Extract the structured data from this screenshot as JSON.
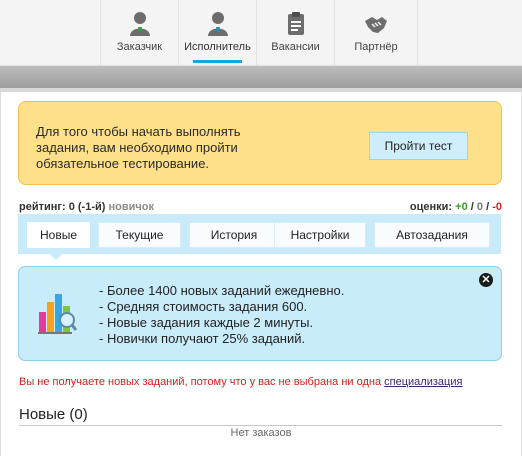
{
  "nav": {
    "tabs": [
      {
        "label": "Заказчик",
        "icon": "customer-user-icon",
        "active": false
      },
      {
        "label": "Исполнитель",
        "icon": "performer-user-icon",
        "active": true
      },
      {
        "label": "Вакансии",
        "icon": "vacancies-document-icon",
        "active": false
      },
      {
        "label": "Партнёр",
        "icon": "partner-handshake-icon",
        "active": false
      }
    ]
  },
  "notice": {
    "text": "Для того чтобы начать выполнять задания, вам необходимо пройти обязательное тестирование.",
    "button_label": "Пройти тест"
  },
  "rating": {
    "label": "рейтинг:",
    "value": "0 (-1-й)",
    "rank": "новичок"
  },
  "grades": {
    "label": "оценки:",
    "positive": "+0",
    "sep1": "/",
    "neutral": "0",
    "sep2": "/",
    "negative": "-0"
  },
  "subtabs": [
    {
      "label": "Новые",
      "active": true
    },
    {
      "label": "Текущие",
      "active": false
    },
    {
      "label": "История",
      "active": false
    },
    {
      "label": "Настройки",
      "active": false
    },
    {
      "label": "Автозадания",
      "active": false
    }
  ],
  "info": {
    "items": [
      "- Более 1400 новых заданий ежедневно.",
      "- Средняя стоимость задания 600.",
      "- Новые задания каждые 2 минуты.",
      "- Новички получают 25% заданий."
    ],
    "close_icon": "close-icon"
  },
  "warning": {
    "text": "Вы не получаете новых заданий, потому что у вас не выбрана ни одна",
    "link": "специализация"
  },
  "section": {
    "title": "Новые (0)",
    "empty_text": "Нет заказов"
  },
  "colors": {
    "accent": "#18a7d9",
    "notice_bg": "#ffe08a",
    "info_bg": "#c9ecfa",
    "warning": "#d21f1f"
  }
}
